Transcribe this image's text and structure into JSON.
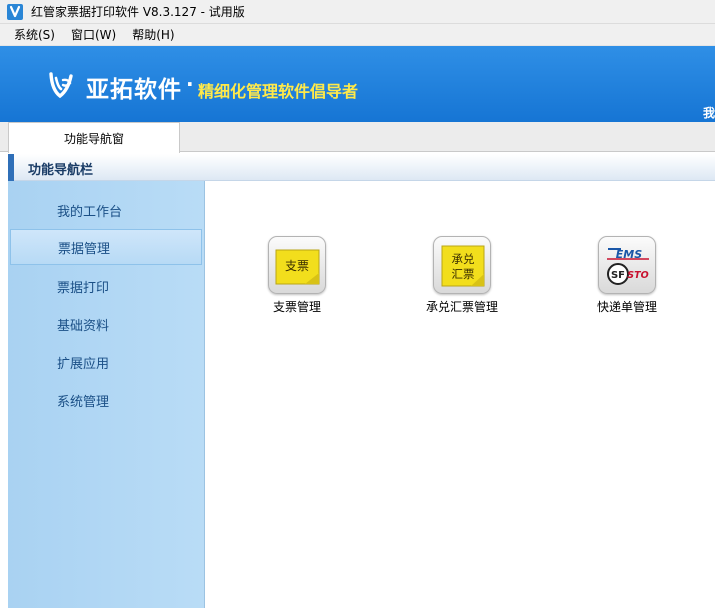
{
  "window": {
    "title": "红管家票据打印软件 V8.3.127 - 试用版",
    "icon": "app-logo-icon"
  },
  "menubar": {
    "items": [
      {
        "label": "系统(S)"
      },
      {
        "label": "窗口(W)"
      },
      {
        "label": "帮助(H)"
      }
    ]
  },
  "banner": {
    "brand": "亚拓软件",
    "dot": "·",
    "slogan": "精细化管理软件倡导者",
    "right_text": "我",
    "colors": {
      "background": "#1675d4",
      "slogan": "#ffe94a"
    }
  },
  "tabs": [
    {
      "label": "功能导航窗"
    }
  ],
  "section": {
    "title": "功能导航栏"
  },
  "sidebar": {
    "items": [
      {
        "label": "我的工作台",
        "active": false
      },
      {
        "label": "票据管理",
        "active": true
      },
      {
        "label": "票据打印",
        "active": false
      },
      {
        "label": "基础资料",
        "active": false
      },
      {
        "label": "扩展应用",
        "active": false
      },
      {
        "label": "系统管理",
        "active": false
      }
    ]
  },
  "main": {
    "tiles": [
      {
        "label": "支票管理",
        "icon": "check-note-icon",
        "icon_text": "支票"
      },
      {
        "label": "承兑汇票管理",
        "icon": "acceptance-bill-icon",
        "icon_text_top": "承兑",
        "icon_text_bottom": "汇票"
      },
      {
        "label": "快递单管理",
        "icon": "express-waybill-icon",
        "icon_text_top": "EMS",
        "icon_text_left": "SF",
        "icon_text_right": "STO"
      }
    ]
  }
}
